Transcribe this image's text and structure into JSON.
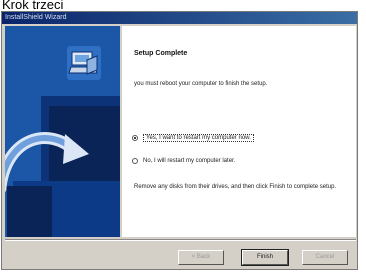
{
  "page_caption": "Krok trzeci",
  "window": {
    "title": "InstallShield Wizard"
  },
  "content": {
    "heading": "Setup Complete",
    "message": "you must reboot your computer to finish the setup.",
    "option_restart_now": "Yes, I want to restart my computer now.",
    "option_restart_later": "No, I will restart my computer later.",
    "instructions": "Remove any disks from their drives, and then click Finish to complete setup.",
    "selected_option": "restart_now"
  },
  "buttons": {
    "back": "< Back",
    "finish": "Finish",
    "cancel": "Cancel"
  },
  "icons": {
    "setup": "computer-box-icon",
    "radio_selected": "radio-selected-icon",
    "radio_unselected": "radio-unselected-icon"
  },
  "colors": {
    "titlebar": "#0a246a",
    "art_panel": "#1b57a6",
    "dialog_bg": "#d4d0c8"
  }
}
